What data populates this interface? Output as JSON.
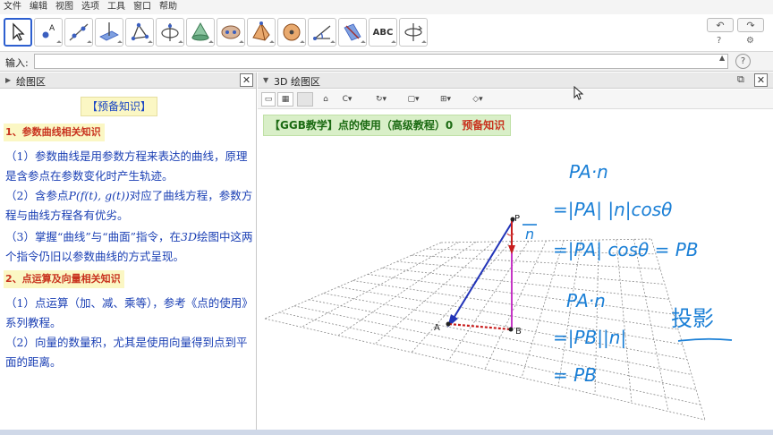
{
  "menu": [
    "文件",
    "编辑",
    "视图",
    "选项",
    "工具",
    "窗口",
    "帮助"
  ],
  "toolbar": {
    "tools": [
      {
        "name": "move-tool",
        "icon": "arrow-pointer-icon",
        "active": true
      },
      {
        "name": "point-tool",
        "icon": "point-icon",
        "label": "A"
      },
      {
        "name": "line-tool",
        "icon": "line-icon"
      },
      {
        "name": "perpendicular-tool",
        "icon": "perpendicular-icon"
      },
      {
        "name": "polygon-tool",
        "icon": "polygon-icon"
      },
      {
        "name": "circle-axis-tool",
        "icon": "circle-axis-icon"
      },
      {
        "name": "cone-tool",
        "icon": "cone-icon"
      },
      {
        "name": "ellipse-tool",
        "icon": "ellipse-icon"
      },
      {
        "name": "pyramid-tool",
        "icon": "pyramid-icon"
      },
      {
        "name": "sphere-tool",
        "icon": "sphere-icon"
      },
      {
        "name": "angle-tool",
        "icon": "angle-icon"
      },
      {
        "name": "reflect-tool",
        "icon": "reflect-icon"
      },
      {
        "name": "text-tool",
        "icon": "text-icon",
        "label": "ABC"
      },
      {
        "name": "rotate-view-tool",
        "icon": "rotate-view-icon"
      }
    ],
    "undo_label": "↶",
    "redo_label": "↷",
    "help_icon": "?",
    "settings_icon": "⚙"
  },
  "inputbar": {
    "label": "输入:",
    "value": "",
    "help": "?"
  },
  "left_panel": {
    "title": "绘图区",
    "badge": "【预备知识】",
    "section1": "1、参数曲线相关知识",
    "p1": "（1）参数曲线是用参数方程来表达的曲线，原理是含参点在参数变化时产生轨迹。",
    "p2_pre": "（2）含参点",
    "p2_math": "P(f(t), g(t))",
    "p2_post": "对应了曲线方程，参数方程与曲线方程各有优劣。",
    "p3_pre": "（3）掌握“曲线”与“曲面”指令，在",
    "p3_math": "3D",
    "p3_post": "绘图中这两个指令仍旧以参数曲线的方式呈现。",
    "section2": "2、点运算及向量相关知识",
    "p4": "（1）点运算（加、减、乘等），参考《点的使用》系列教程。",
    "p5": "（2）向量的数量积，尤其是使用向量得到点到平面的距离。"
  },
  "right_panel": {
    "title": "3D 绘图区",
    "banner_main": "【GGB教学】点的使用（高级教程）0",
    "banner_tag": "预备知识",
    "points": {
      "P": "P",
      "A": "A",
      "B": "B",
      "n": "n"
    },
    "handwriting": {
      "l1": "PA·n",
      "l2": "=|PA| |n|cosθ",
      "l3": "=|PA| cosθ = PB",
      "l4": "PA·n",
      "l5": "=|PB||n|",
      "l6": "= PB",
      "note": "投影"
    }
  },
  "colors": {
    "accent": "#2d5fd0",
    "text_blue": "#1a3fb4",
    "heading_red": "#c8321e",
    "banner_green": "#d9efc8",
    "handwriting": "#1a7fd6"
  }
}
